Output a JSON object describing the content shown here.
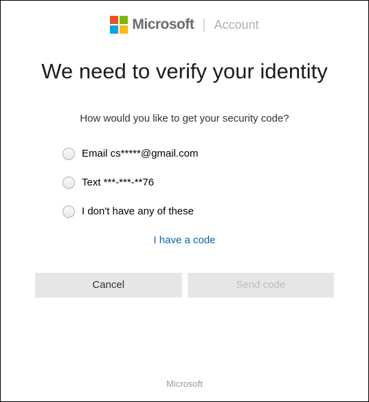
{
  "header": {
    "brand": "Microsoft",
    "section": "Account"
  },
  "title": "We need to verify your identity",
  "subtitle": "How would you like to get your security code?",
  "options": [
    {
      "label": "Email cs*****@gmail.com"
    },
    {
      "label": "Text ***-***-**76"
    },
    {
      "label": "I don't have any of these"
    }
  ],
  "link": {
    "have_code": "I have a code"
  },
  "buttons": {
    "cancel": "Cancel",
    "send_code": "Send code"
  },
  "footer": {
    "brand": "Microsoft"
  }
}
